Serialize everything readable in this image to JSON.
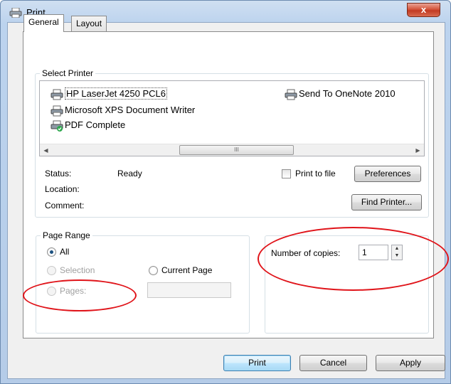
{
  "window": {
    "title": "Print",
    "close_glyph": "x",
    "icon": "printer-icon"
  },
  "tabs": [
    {
      "label": "General",
      "active": true
    },
    {
      "label": "Layout",
      "active": false
    }
  ],
  "select_printer": {
    "group_label": "Select Printer",
    "printers": [
      {
        "name": "HP LaserJet 4250 PCL6",
        "icon": "printer-icon",
        "selected": true
      },
      {
        "name": "Send To OneNote 2010",
        "icon": "printer-icon",
        "selected": false
      },
      {
        "name": "Microsoft XPS Document Writer",
        "icon": "printer-icon",
        "selected": false
      },
      {
        "name": "PDF Complete",
        "icon": "printer-check-icon",
        "selected": false
      }
    ],
    "scroll_left": "◀",
    "scroll_right": "▶",
    "scroll_thumb_grip": "III",
    "status_label": "Status:",
    "status_value": "Ready",
    "location_label": "Location:",
    "comment_label": "Comment:",
    "print_to_file": {
      "label": "Print to file",
      "checked": false
    },
    "preferences_button": "Preferences",
    "find_printer_button": "Find Printer..."
  },
  "page_range": {
    "group_label": "Page Range",
    "options": {
      "all": "All",
      "selection": "Selection",
      "current_page": "Current Page",
      "pages": "Pages:"
    },
    "selected": "all",
    "pages_value": ""
  },
  "copies": {
    "label": "Number of copies:",
    "value": "1"
  },
  "footer": {
    "print": "Print",
    "cancel": "Cancel",
    "apply": "Apply"
  },
  "colors": {
    "annotation": "#e0141a",
    "frame": "#b5cce8"
  }
}
